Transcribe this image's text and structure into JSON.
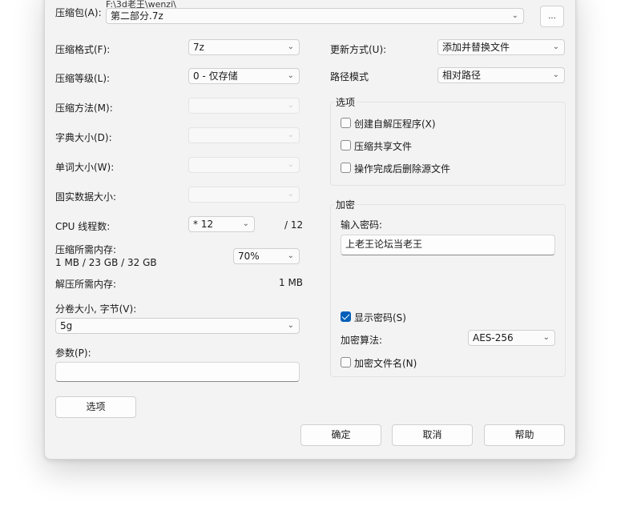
{
  "archive": {
    "label": "压缩包(A):",
    "path_text": "F:\\3d老王\\wenzi\\",
    "name_value": "第二部分.7z",
    "browse_label": "..."
  },
  "left": {
    "format_label": "压缩格式(F):",
    "format_value": "7z",
    "level_label": "压缩等级(L):",
    "level_value": "0 - 仅存储",
    "method_label": "压缩方法(M):",
    "dict_label": "字典大小(D):",
    "word_label": "单词大小(W):",
    "solid_label": "固实数据大小:",
    "cpu_label": "CPU 线程数:",
    "cpu_value": "* 12",
    "cpu_total": "/ 12",
    "mem_compress_label": "压缩所需内存:",
    "mem_compress_info": "1 MB / 23 GB / 32 GB",
    "mem_percent": "70%",
    "mem_decompress_label": "解压所需内存:",
    "mem_decompress_value": "1 MB",
    "volume_label": "分卷大小, 字节(V):",
    "volume_value": "5g",
    "params_label": "参数(P):",
    "params_value": "",
    "options_button": "选项"
  },
  "right": {
    "update_label": "更新方式(U):",
    "update_value": "添加并替换文件",
    "path_mode_label": "路径模式",
    "path_mode_value": "相对路径",
    "options_group_title": "选项",
    "sfx_label": "创建自解压程序(X)",
    "shared_label": "压缩共享文件",
    "delete_label": "操作完成后删除源文件",
    "encrypt_group_title": "加密",
    "password_label": "输入密码:",
    "password_value": "上老王论坛当老王",
    "show_password_label": "显示密码(S)",
    "show_password_checked": true,
    "enc_method_label": "加密算法:",
    "enc_method_value": "AES-256",
    "encrypt_names_label": "加密文件名(N)"
  },
  "buttons": {
    "ok": "确定",
    "cancel": "取消",
    "help": "帮助"
  },
  "colors": {
    "accent": "#005fb8",
    "dialog_bg": "#f3f3f3"
  }
}
